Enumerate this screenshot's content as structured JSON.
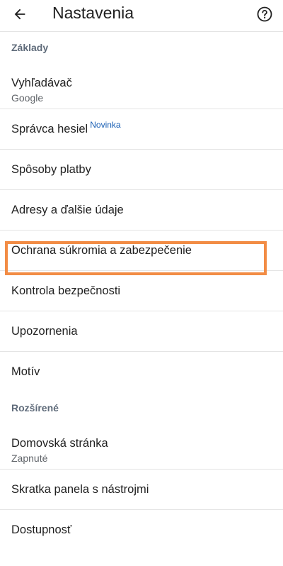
{
  "appbar": {
    "title": "Nastavenia",
    "back_icon": "arrow-left-icon",
    "help_icon": "help-circle-icon"
  },
  "sections": {
    "basics": "Základy",
    "advanced": "Rozšírené"
  },
  "items": {
    "search_engine": {
      "label": "Vyhľadávač",
      "sub": "Google"
    },
    "password_manager": {
      "label": "Správca hesiel",
      "badge": "Novinka"
    },
    "payment_methods": {
      "label": "Spôsoby platby"
    },
    "addresses": {
      "label": "Adresy a ďalšie údaje"
    },
    "privacy_security": {
      "label": "Ochrana súkromia a zabezpečenie"
    },
    "safety_check": {
      "label": "Kontrola bezpečnosti"
    },
    "notifications": {
      "label": "Upozornenia"
    },
    "theme": {
      "label": "Motív"
    },
    "homepage": {
      "label": "Domovská stránka",
      "sub": "Zapnuté"
    },
    "toolbar_shortcut": {
      "label": "Skratka panela s nástrojmi"
    },
    "accessibility": {
      "label": "Dostupnosť"
    }
  },
  "colors": {
    "highlight": "#f28c45",
    "badge": "#1a5fb4",
    "section_header": "#5f6b7a"
  }
}
